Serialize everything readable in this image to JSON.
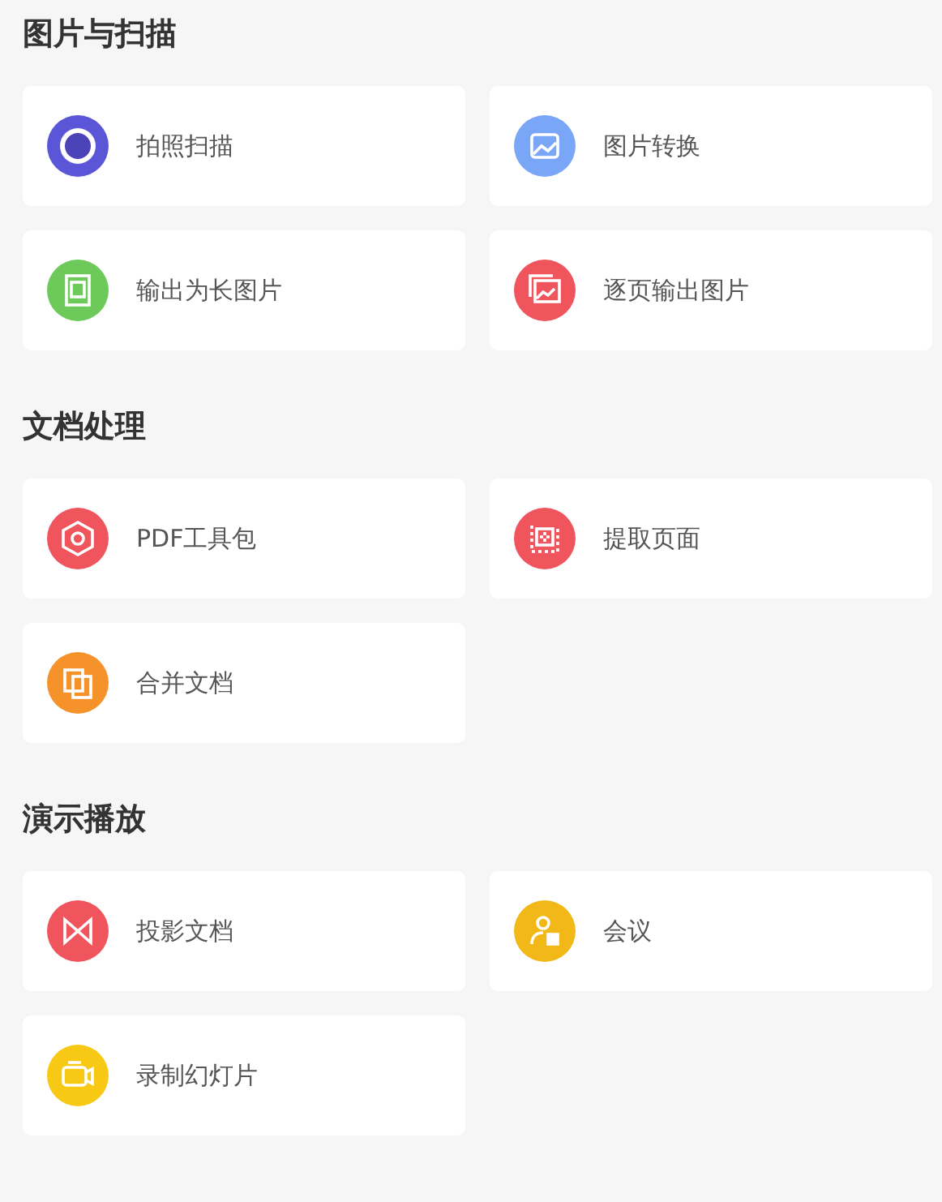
{
  "sections": [
    {
      "title": "图片与扫描",
      "items": [
        {
          "label": "拍照扫描",
          "kind": "scan",
          "color": "#5b55d8"
        },
        {
          "label": "图片转换",
          "kind": "image",
          "color": "#7aa6f7"
        },
        {
          "label": "输出为长图片",
          "kind": "long-image",
          "color": "#6cc95a"
        },
        {
          "label": "逐页输出图片",
          "kind": "pages-image",
          "color": "#f0545c"
        }
      ]
    },
    {
      "title": "文档处理",
      "items": [
        {
          "label": "PDF工具包",
          "kind": "hexagon",
          "color": "#f0545c"
        },
        {
          "label": "提取页面",
          "kind": "extract",
          "color": "#f0545c"
        },
        {
          "label": "合并文档",
          "kind": "merge",
          "color": "#f5922a"
        }
      ]
    },
    {
      "title": "演示播放",
      "items": [
        {
          "label": "投影文档",
          "kind": "bowtie",
          "color": "#f0545c"
        },
        {
          "label": "会议",
          "kind": "person",
          "color": "#f2b818"
        },
        {
          "label": "录制幻灯片",
          "kind": "camera",
          "color": "#f7c915"
        }
      ]
    }
  ]
}
